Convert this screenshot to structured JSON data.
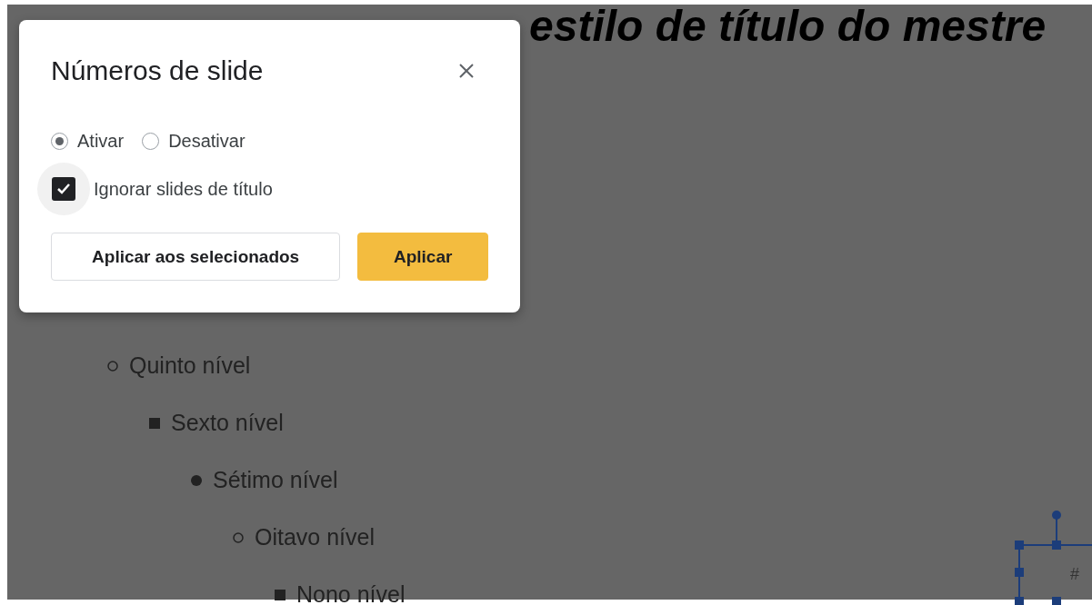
{
  "slide": {
    "title_fragment": "estilo de título do mestre",
    "bullets": [
      {
        "text": "Quinto nível",
        "kind": "hollow",
        "children": [
          {
            "text": "Sexto nível",
            "kind": "square",
            "children": [
              {
                "text": "Sétimo nível",
                "kind": "disc",
                "children": [
                  {
                    "text": "Oitavo nível",
                    "kind": "hollow",
                    "children": [
                      {
                        "text": "Nono nível",
                        "kind": "square"
                      }
                    ]
                  }
                ]
              }
            ]
          }
        ]
      }
    ],
    "number_placeholder": "#"
  },
  "dialog": {
    "title": "Números de slide",
    "radios": [
      {
        "label": "Ativar",
        "selected": true
      },
      {
        "label": "Desativar",
        "selected": false
      }
    ],
    "checkbox": {
      "label": "Ignorar slides de título",
      "checked": true
    },
    "buttons": [
      {
        "label": "Aplicar aos selecionados",
        "kind": "secondary"
      },
      {
        "label": "Aplicar",
        "kind": "primary"
      }
    ]
  }
}
